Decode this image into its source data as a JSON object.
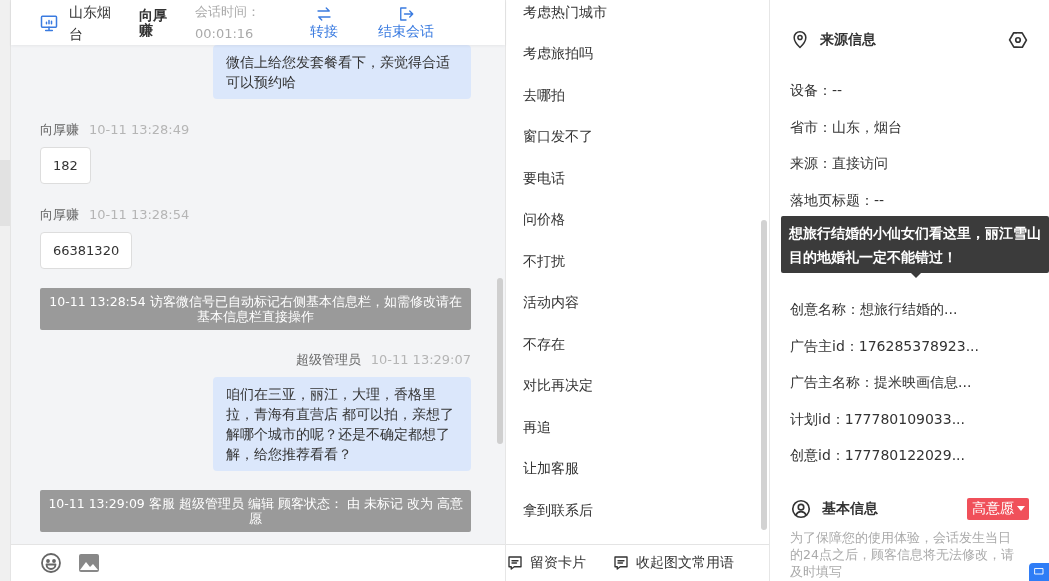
{
  "header": {
    "location": "山东烟台",
    "visitor": "向厚赚",
    "duration_label": "会话时间：",
    "duration": "00:01:16",
    "actions": [
      {
        "kind": "transfer",
        "label": "转接"
      },
      {
        "kind": "end",
        "label": "结束会话"
      }
    ]
  },
  "messages": [
    {
      "kind": "agent",
      "text": "微信上给您发套餐看下，亲觉得合适可以预约哈"
    },
    {
      "kind": "visitor",
      "sender": "向厚赚",
      "time": "10-11 13:28:49",
      "text": "182"
    },
    {
      "kind": "visitor",
      "sender": "向厚赚",
      "time": "10-11 13:28:54",
      "text": "66381320"
    },
    {
      "kind": "system",
      "text": "10-11 13:28:54 访客微信号已自动标记右侧基本信息栏，如需修改请在基本信息栏直接操作"
    },
    {
      "kind": "agent",
      "sender": "超级管理员",
      "time": "10-11 13:29:07",
      "text": "咱们在三亚，丽江，大理，香格里拉，青海有直营店 都可以拍，亲想了解哪个城市的呢？还是不确定都想了解，给您推荐看看？"
    },
    {
      "kind": "system",
      "text": "10-11 13:29:09 客服 超级管理员 编辑 顾客状态： 由 未标记 改为 高意愿"
    }
  ],
  "phrases": [
    "考虑热门城市",
    "考虑旅拍吗",
    "去哪拍",
    "窗口发不了",
    "要电话",
    "问价格",
    "不打扰",
    "活动内容",
    "不存在",
    "对比再决定",
    "再追",
    "让加客服",
    "拿到联系后"
  ],
  "phrase_actions": [
    "留资卡片",
    "收起图文常用语"
  ],
  "source_info": {
    "title": "来源信息",
    "fields": [
      {
        "kind": "text",
        "text": "设备：--"
      },
      {
        "kind": "text",
        "text": "省市：山东，烟台"
      },
      {
        "kind": "text",
        "text": "来源：直接访问"
      },
      {
        "kind": "text",
        "text": "落地页标题：--"
      },
      {
        "kind": "hidden"
      },
      {
        "kind": "hidden"
      },
      {
        "kind": "text",
        "text": "创意名称：想旅行结婚的..."
      },
      {
        "kind": "text",
        "text": "广告主id：176285378923..."
      },
      {
        "kind": "text",
        "text": "广告主名称：提米映画信息..."
      },
      {
        "kind": "text",
        "text": "计划id：177780109033..."
      },
      {
        "kind": "text",
        "text": "创意id：177780122029..."
      }
    ],
    "tooltip": "想旅行结婚的小仙女们看这里，丽江雪山目的地婚礼一定不能错过！"
  },
  "basic_info": {
    "title": "基本信息",
    "status": "高意愿",
    "note": "为了保障您的使用体验，会话发生当日的24点之后，顾客信息将无法修改，请及时填写"
  }
}
